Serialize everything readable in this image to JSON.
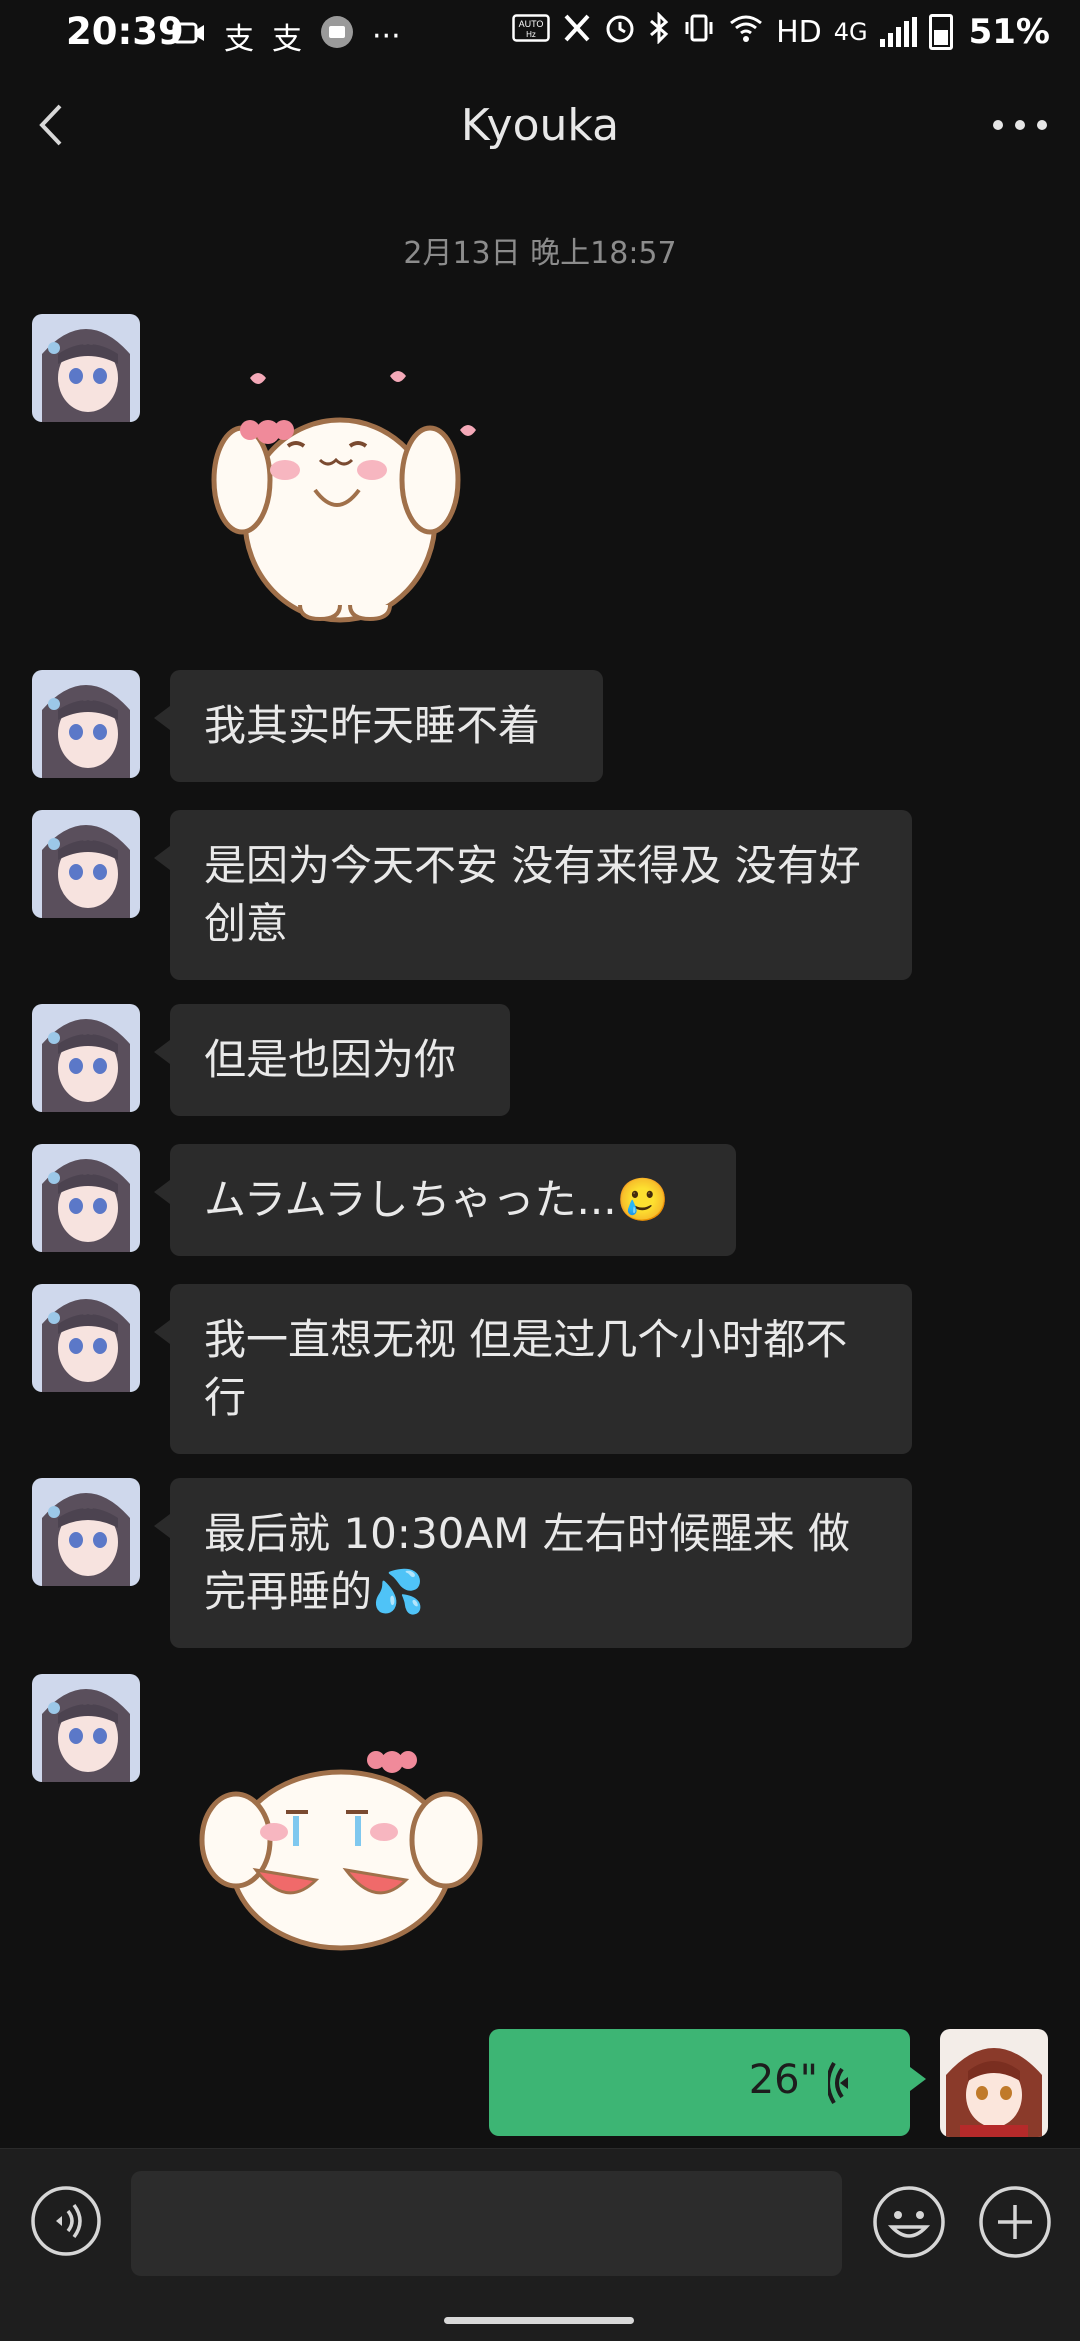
{
  "status_bar": {
    "time": "20:39",
    "left_icons": [
      "video-icon",
      "alipay-icon",
      "alipay-icon",
      "mail-icon",
      "more-dots-icon"
    ],
    "right_icons": [
      "auto-hz-icon",
      "x-icon",
      "alarm-icon",
      "bluetooth-icon",
      "vibrate-icon",
      "wifi-icon",
      "hd-icon",
      "4g-icon",
      "signal-icon",
      "battery-icon"
    ],
    "hd": "HD",
    "network": "4G",
    "battery": "51%"
  },
  "header": {
    "title": "Kyouka"
  },
  "timestamp": "2月13日 晚上18:57",
  "messages": [
    {
      "type": "sticker",
      "sticker": "happy-bunny-sticker"
    },
    {
      "type": "text",
      "text": "我其实昨天睡不着"
    },
    {
      "type": "text",
      "text": "是因为今天不安 没有来得及 没有好创意"
    },
    {
      "type": "text",
      "text": "但是也因为你"
    },
    {
      "type": "text",
      "text": "ムラムラしちゃった...🥲"
    },
    {
      "type": "text",
      "text": "我一直想无视 但是过几个小时都不行"
    },
    {
      "type": "text",
      "text": "最后就 10:30AM 左右时候醒来 做完再睡的💦"
    },
    {
      "type": "sticker",
      "sticker": "crying-bunny-sticker"
    }
  ],
  "voice_message": {
    "duration": "26\"",
    "icon": "voice-wave-icon"
  },
  "colors": {
    "background": "#111111",
    "bubble": "#2b2b2b",
    "voice_bubble": "#3db574"
  }
}
